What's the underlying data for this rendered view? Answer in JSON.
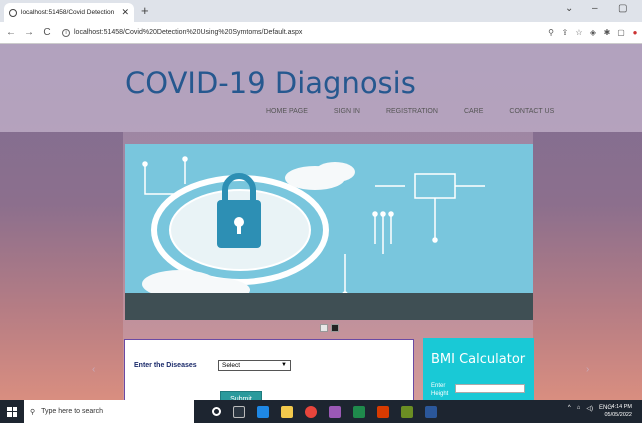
{
  "browser": {
    "tab_title": "localhost:51458/Covid Detection",
    "url": "localhost:51458/Covid%20Detection%20Using%20Symtoms/Default.aspx"
  },
  "site": {
    "title": "COVID-19 Diagnosis",
    "nav": [
      "HOME PAGE",
      "SIGN IN",
      "REGISTRATION",
      "CARE",
      "CONTACT US"
    ]
  },
  "disease_form": {
    "label": "Enter the Diseases",
    "select_value": "Select",
    "submit_label": "Submit"
  },
  "bmi": {
    "title": "BMI Calculator",
    "height_label": "Enter Height"
  },
  "taskbar": {
    "search_placeholder": "Type here to search",
    "language": "ENG",
    "time": "4:14 PM",
    "date": "05/05/2022"
  }
}
